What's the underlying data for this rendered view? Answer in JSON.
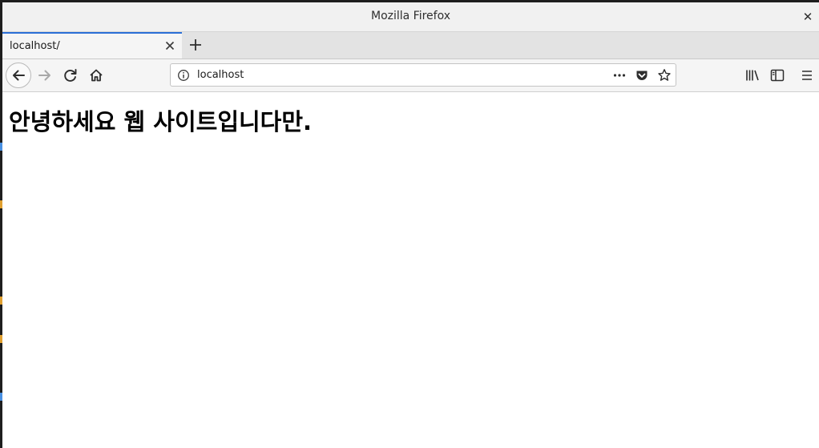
{
  "window": {
    "title": "Mozilla Firefox",
    "close_label": "✕"
  },
  "tabs": [
    {
      "label": "localhost/",
      "active": true
    }
  ],
  "navbar": {
    "url": "localhost",
    "icons": {
      "back": "back-arrow-icon",
      "forward": "forward-arrow-icon",
      "reload": "reload-icon",
      "home": "home-icon",
      "page_actions": "more-horizontal-icon",
      "pocket": "pocket-icon",
      "bookmark": "star-icon",
      "library": "library-icon",
      "sidebar": "sidebar-icon",
      "menu": "hamburger-menu-icon"
    }
  },
  "page": {
    "heading": "안녕하세요 웹 사이트입니다만."
  },
  "colors": {
    "tab_accent": "#2b6fd6",
    "chrome_bg": "#f5f5f5",
    "titlebar_bg": "#f1f1f1"
  }
}
